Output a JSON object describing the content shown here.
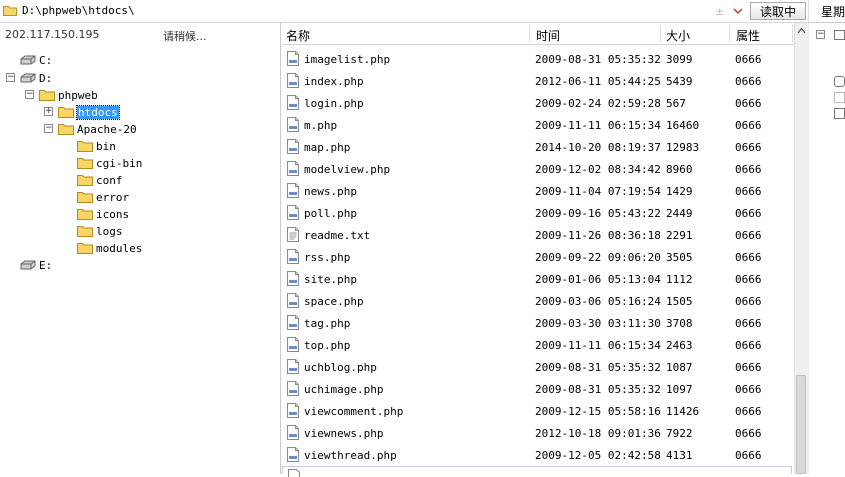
{
  "address": {
    "path": "D:\\phpweb\\htdocs\\",
    "read_button": "读取中"
  },
  "right_panel": {
    "label": "星期"
  },
  "left": {
    "ip": "202.117.150.195",
    "status": "请稍候...",
    "tree": [
      {
        "label": "C:",
        "type": "drive",
        "expander": "",
        "selected": false
      },
      {
        "label": "D:",
        "type": "drive",
        "expander": "−",
        "selected": false
      },
      {
        "label": "phpweb",
        "type": "folder",
        "expander": "−",
        "selected": false
      },
      {
        "label": "htdocs",
        "type": "folder",
        "expander": "+",
        "selected": true
      },
      {
        "label": "Apache-20",
        "type": "folder",
        "expander": "−",
        "selected": false
      },
      {
        "label": "bin",
        "type": "folder",
        "expander": "",
        "selected": false
      },
      {
        "label": "cgi-bin",
        "type": "folder",
        "expander": "",
        "selected": false
      },
      {
        "label": "conf",
        "type": "folder",
        "expander": "",
        "selected": false
      },
      {
        "label": "error",
        "type": "folder",
        "expander": "",
        "selected": false
      },
      {
        "label": "icons",
        "type": "folder",
        "expander": "",
        "selected": false
      },
      {
        "label": "logs",
        "type": "folder",
        "expander": "",
        "selected": false
      },
      {
        "label": "modules",
        "type": "folder",
        "expander": "",
        "selected": false
      },
      {
        "label": "E:",
        "type": "drive",
        "expander": "",
        "selected": false
      }
    ]
  },
  "columns": {
    "name": "名称",
    "time": "时间",
    "size": "大小",
    "attr": "属性"
  },
  "files": [
    {
      "name": "imagelist.php",
      "time": "2009-08-31 05:35:32",
      "size": "3099",
      "attr": "0666"
    },
    {
      "name": "index.php",
      "time": "2012-06-11 05:44:25",
      "size": "5439",
      "attr": "0666"
    },
    {
      "name": "login.php",
      "time": "2009-02-24 02:59:28",
      "size": "567",
      "attr": "0666"
    },
    {
      "name": "m.php",
      "time": "2009-11-11 06:15:34",
      "size": "16460",
      "attr": "0666"
    },
    {
      "name": "map.php",
      "time": "2014-10-20 08:19:37",
      "size": "12983",
      "attr": "0666"
    },
    {
      "name": "modelview.php",
      "time": "2009-12-02 08:34:42",
      "size": "8960",
      "attr": "0666"
    },
    {
      "name": "news.php",
      "time": "2009-11-04 07:19:54",
      "size": "1429",
      "attr": "0666"
    },
    {
      "name": "poll.php",
      "time": "2009-09-16 05:43:22",
      "size": "2449",
      "attr": "0666"
    },
    {
      "name": "readme.txt",
      "time": "2009-11-26 08:36:18",
      "size": "2291",
      "attr": "0666"
    },
    {
      "name": "rss.php",
      "time": "2009-09-22 09:06:20",
      "size": "3505",
      "attr": "0666"
    },
    {
      "name": "site.php",
      "time": "2009-01-06 05:13:04",
      "size": "1112",
      "attr": "0666"
    },
    {
      "name": "space.php",
      "time": "2009-03-06 05:16:24",
      "size": "1505",
      "attr": "0666"
    },
    {
      "name": "tag.php",
      "time": "2009-03-30 03:11:30",
      "size": "3708",
      "attr": "0666"
    },
    {
      "name": "top.php",
      "time": "2009-11-11 06:15:34",
      "size": "2463",
      "attr": "0666"
    },
    {
      "name": "uchblog.php",
      "time": "2009-08-31 05:35:32",
      "size": "1087",
      "attr": "0666"
    },
    {
      "name": "uchimage.php",
      "time": "2009-08-31 05:35:32",
      "size": "1097",
      "attr": "0666"
    },
    {
      "name": "viewcomment.php",
      "time": "2009-12-15 05:58:16",
      "size": "11426",
      "attr": "0666"
    },
    {
      "name": "viewnews.php",
      "time": "2012-10-18 09:01:36",
      "size": "7922",
      "attr": "0666"
    },
    {
      "name": "viewthread.php",
      "time": "2009-12-05 02:42:58",
      "size": "4131",
      "attr": "0666"
    }
  ]
}
